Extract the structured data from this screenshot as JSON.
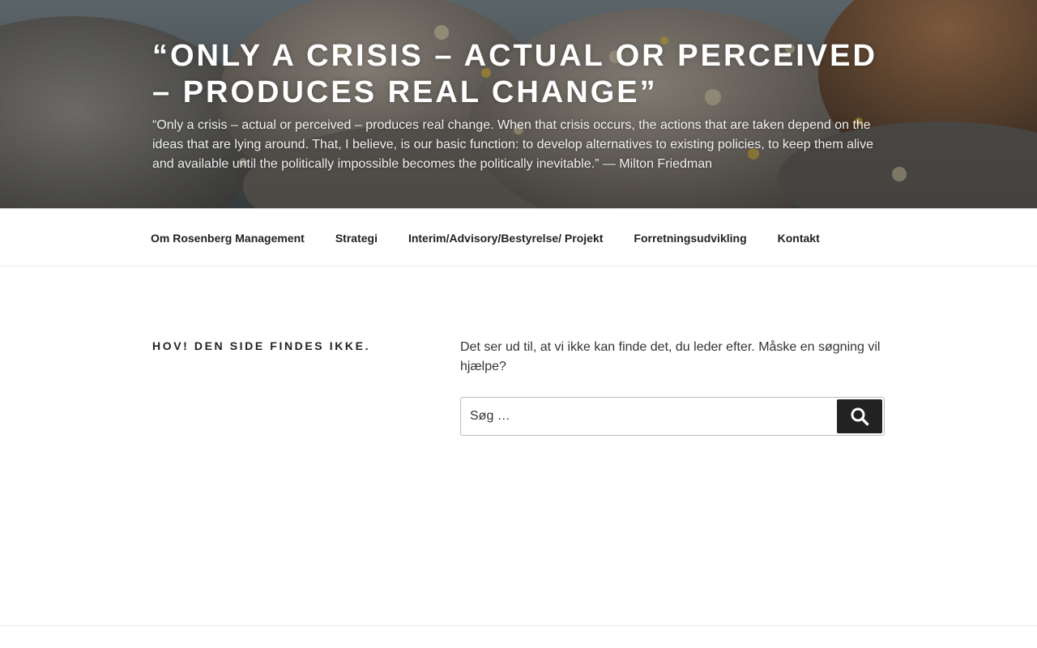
{
  "header": {
    "title": "“Only a crisis – actual or perceived – produces real change”",
    "description": "“Only a crisis – actual or perceived – produces real change. When that crisis occurs, the actions that are taken depend on the ideas that are lying around. That, I believe, is our basic function: to develop alternatives to existing policies, to keep them alive and available until the politically impossible becomes the politically inevitable.” — Milton Friedman"
  },
  "nav": {
    "items": [
      {
        "label": "Om Rosenberg Management"
      },
      {
        "label": "Strategi"
      },
      {
        "label": "Interim/Advisory/Bestyrelse/ Projekt"
      },
      {
        "label": "Forretningsudvikling"
      },
      {
        "label": "Kontakt"
      }
    ]
  },
  "main": {
    "page_title": "Hov! Den side findes ikke.",
    "message": "Det ser ud til, at vi ikke kan finde det, du leder efter. Måske en søgning vil hjælpe?",
    "search": {
      "placeholder": "Søg …",
      "value": "",
      "button_icon": "search-icon"
    }
  },
  "colors": {
    "button_bg": "#222222",
    "text": "#222222"
  }
}
